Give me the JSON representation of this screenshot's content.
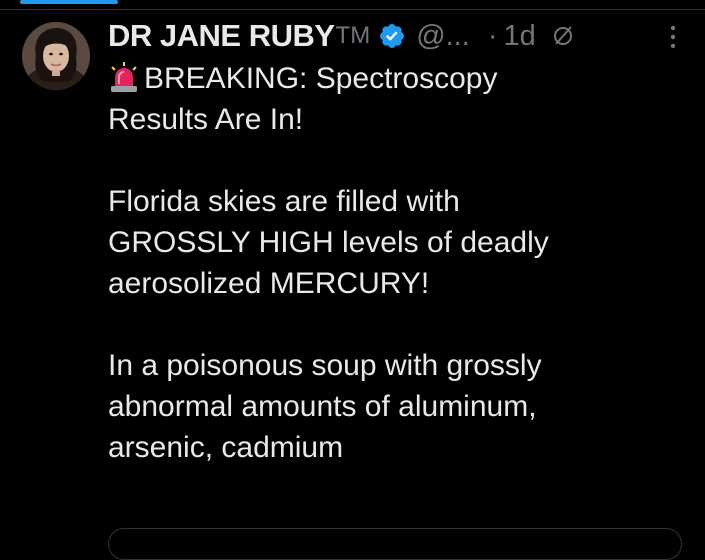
{
  "post": {
    "author": {
      "display_name": "DR JANE RUBY",
      "trademark": "TM",
      "handle": "@...",
      "verified": true,
      "avatar_icon": "profile-photo"
    },
    "separator": "·",
    "timestamp": "1d",
    "paragraphs": {
      "p1_emoji": "rotating-light",
      "p1_line1": "BREAKING: Spectroscopy",
      "p1_line2": "Results Are In!",
      "p2_line1": "Florida skies are filled with",
      "p2_line2": "GROSSLY HIGH levels of deadly",
      "p2_line3": "aerosolized MERCURY!",
      "p3_line1": "In a poisonous soup with grossly",
      "p3_line2": "abnormal amounts of aluminum,",
      "p3_line3": "arsenic, cadmium"
    }
  },
  "colors": {
    "background": "#000000",
    "text": "#e7e9ea",
    "muted": "#71767b",
    "accent": "#1d9bf0",
    "divider": "#2f3336"
  }
}
